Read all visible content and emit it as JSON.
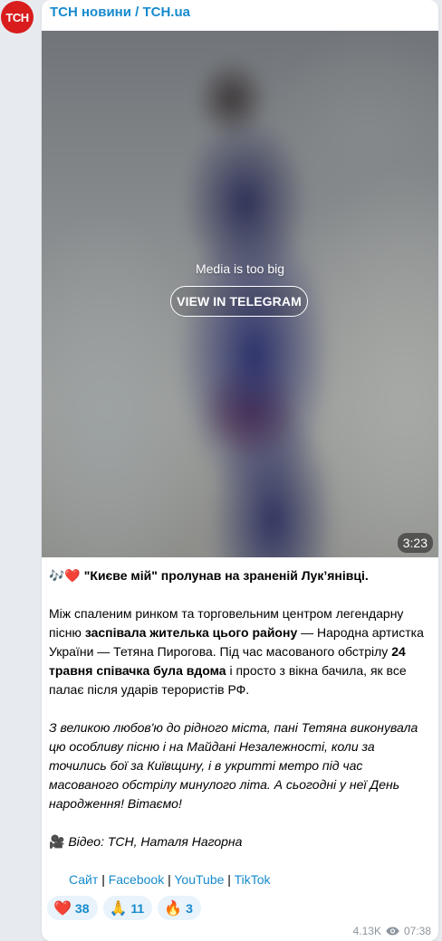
{
  "channel": {
    "avatar_text": "ТСН",
    "title": "ТСН новини / TCH.ua",
    "brand_color": "#d91c1c",
    "accent_color": "#168acd"
  },
  "media": {
    "message": "Media is too big",
    "button_label": "VIEW IN TELEGRAM",
    "duration": "3:23"
  },
  "post": {
    "headline_emoji": "🎶❤️",
    "headline": "\"Києве мій\" пролунав на зраненій Лук’янівці.",
    "p1_a": "Між спаленим ринком та торговельним центром легендарну пісню ",
    "p1_b": "заспівала жителька цього району",
    "p1_c": " — Народна артистка України — Тетяна Пирогова. Під час масованого обстрілу ",
    "p1_d": "24 травня співачка була вдома",
    "p1_e": " і просто з вікна бачила, як все палає після ударів терористів РФ.",
    "p2": "З великою любов'ю до рідного міста, пані Тетяна виконувала цю особливу пісню і на Майдані Незалежності, коли за точились бої за Київщину, і в укритті метро під час масованого обстрілу минулого літа. А сьогодні у неї День народження! Вітаємо!",
    "credit_emoji": "🎥",
    "credit": "Відео: ТСН, Наталя Нагорна",
    "links": [
      "Сайт",
      "Facebook",
      "YouTube",
      "TikTok"
    ],
    "separator": "|"
  },
  "reactions": [
    {
      "emoji": "❤️",
      "icon": "heart-icon",
      "count": "38"
    },
    {
      "emoji": "🙏",
      "icon": "pray-icon",
      "count": "11"
    },
    {
      "emoji": "🔥",
      "icon": "fire-icon",
      "count": "3"
    }
  ],
  "meta": {
    "views": "4.13K",
    "time": "07:38",
    "views_icon": "eye-icon"
  }
}
